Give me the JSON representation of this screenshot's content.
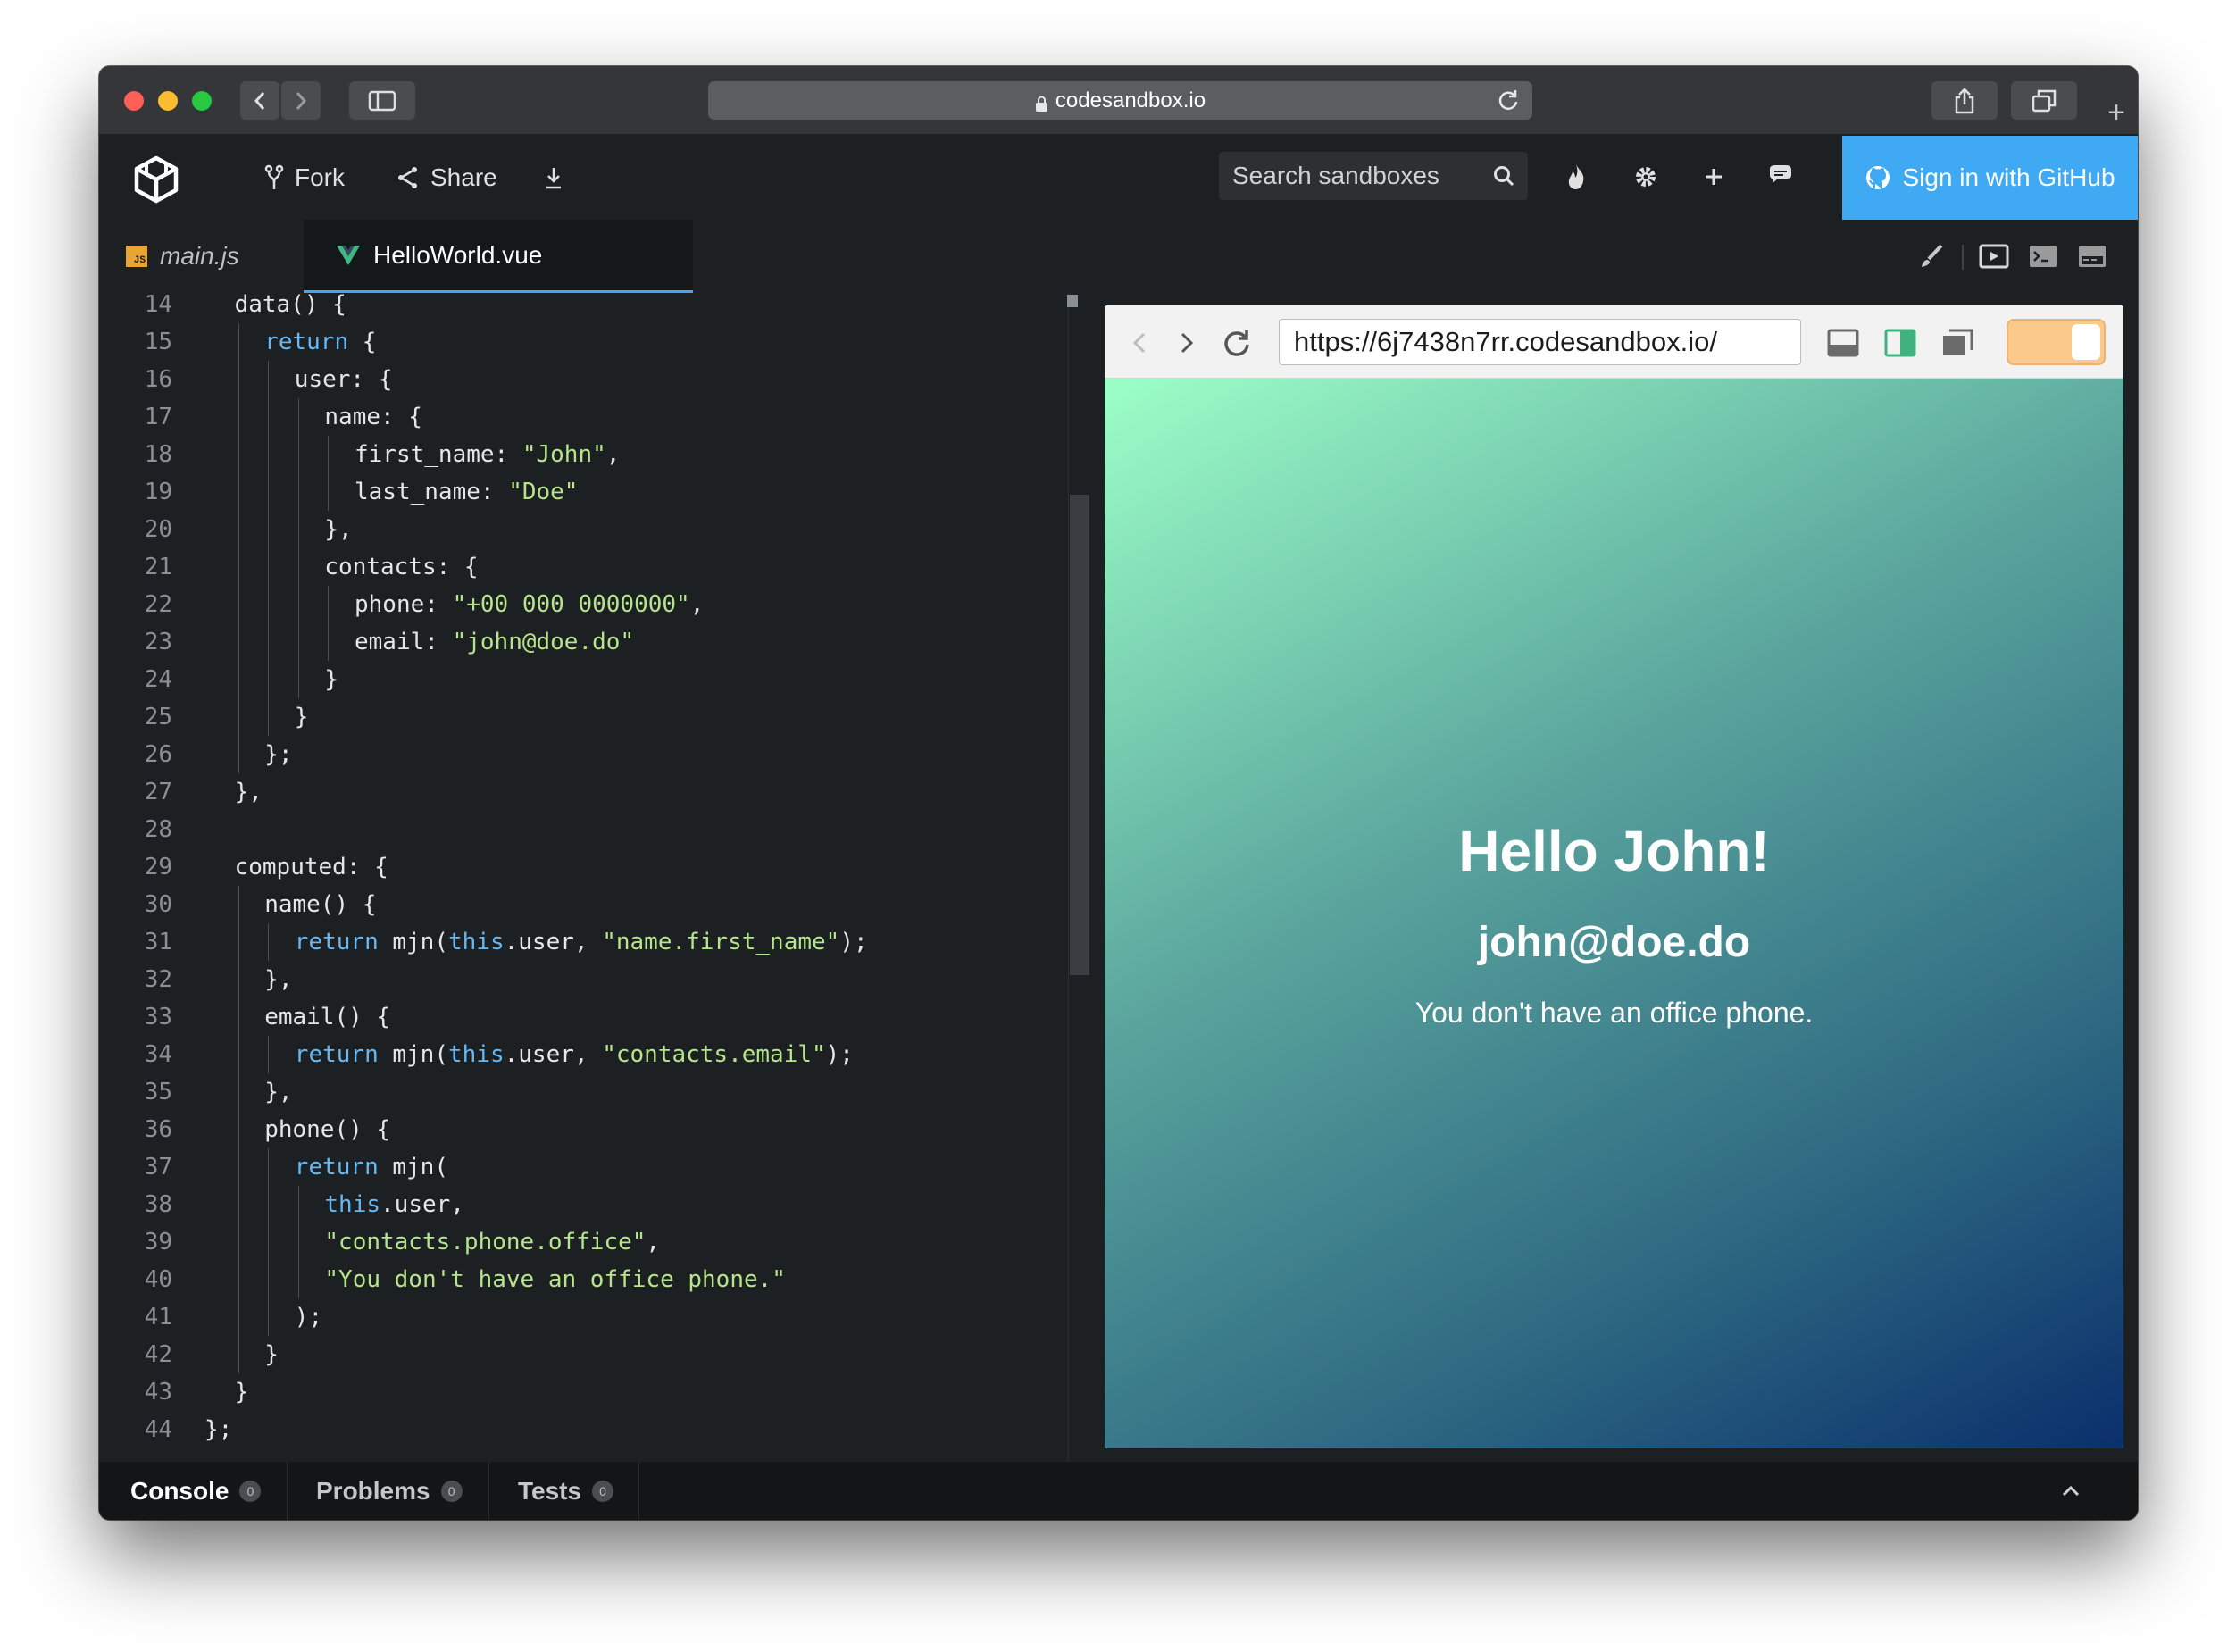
{
  "browser_chrome": {
    "address": "codesandbox.io",
    "traffic_lights": [
      "#fe5f57",
      "#febc2e",
      "#28c840"
    ]
  },
  "header": {
    "fork_label": "Fork",
    "share_label": "Share",
    "search_placeholder": "Search sandboxes",
    "github_label": "Sign in with GitHub",
    "github_color": "#40a9f3"
  },
  "tabs": [
    {
      "label": "main.js",
      "icon": "js-file-icon",
      "active": false
    },
    {
      "label": "HelloWorld.vue",
      "icon": "vue-icon",
      "active": true
    }
  ],
  "editor": {
    "lines": [
      {
        "n": "14",
        "indent": 1,
        "segs": [
          {
            "t": "data() {",
            "c": ""
          }
        ]
      },
      {
        "n": "15",
        "indent": 2,
        "segs": [
          {
            "t": "return",
            "c": "kw"
          },
          {
            "t": " {",
            "c": ""
          }
        ]
      },
      {
        "n": "16",
        "indent": 3,
        "segs": [
          {
            "t": "user: {",
            "c": ""
          }
        ]
      },
      {
        "n": "17",
        "indent": 4,
        "segs": [
          {
            "t": "name: {",
            "c": ""
          }
        ]
      },
      {
        "n": "18",
        "indent": 5,
        "segs": [
          {
            "t": "first_name: ",
            "c": ""
          },
          {
            "t": "\"John\"",
            "c": "str"
          },
          {
            "t": ",",
            "c": ""
          }
        ]
      },
      {
        "n": "19",
        "indent": 5,
        "segs": [
          {
            "t": "last_name: ",
            "c": ""
          },
          {
            "t": "\"Doe\"",
            "c": "str"
          }
        ]
      },
      {
        "n": "20",
        "indent": 4,
        "segs": [
          {
            "t": "},",
            "c": ""
          }
        ]
      },
      {
        "n": "21",
        "indent": 4,
        "segs": [
          {
            "t": "contacts: {",
            "c": ""
          }
        ]
      },
      {
        "n": "22",
        "indent": 5,
        "segs": [
          {
            "t": "phone: ",
            "c": ""
          },
          {
            "t": "\"+00 000 0000000\"",
            "c": "str"
          },
          {
            "t": ",",
            "c": ""
          }
        ]
      },
      {
        "n": "23",
        "indent": 5,
        "segs": [
          {
            "t": "email: ",
            "c": ""
          },
          {
            "t": "\"john@doe.do\"",
            "c": "str"
          }
        ]
      },
      {
        "n": "24",
        "indent": 4,
        "segs": [
          {
            "t": "}",
            "c": ""
          }
        ]
      },
      {
        "n": "25",
        "indent": 3,
        "segs": [
          {
            "t": "}",
            "c": ""
          }
        ]
      },
      {
        "n": "26",
        "indent": 2,
        "segs": [
          {
            "t": "};",
            "c": ""
          }
        ]
      },
      {
        "n": "27",
        "indent": 1,
        "segs": [
          {
            "t": "},",
            "c": ""
          }
        ]
      },
      {
        "n": "28",
        "indent": 0,
        "segs": []
      },
      {
        "n": "29",
        "indent": 1,
        "segs": [
          {
            "t": "computed: {",
            "c": ""
          }
        ]
      },
      {
        "n": "30",
        "indent": 2,
        "segs": [
          {
            "t": "name() {",
            "c": ""
          }
        ]
      },
      {
        "n": "31",
        "indent": 3,
        "segs": [
          {
            "t": "return",
            "c": "kw"
          },
          {
            "t": " mjn(",
            "c": ""
          },
          {
            "t": "this",
            "c": "kw"
          },
          {
            "t": ".user, ",
            "c": ""
          },
          {
            "t": "\"name.first_name\"",
            "c": "str"
          },
          {
            "t": ");",
            "c": ""
          }
        ]
      },
      {
        "n": "32",
        "indent": 2,
        "segs": [
          {
            "t": "},",
            "c": ""
          }
        ]
      },
      {
        "n": "33",
        "indent": 2,
        "segs": [
          {
            "t": "email() {",
            "c": ""
          }
        ]
      },
      {
        "n": "34",
        "indent": 3,
        "segs": [
          {
            "t": "return",
            "c": "kw"
          },
          {
            "t": " mjn(",
            "c": ""
          },
          {
            "t": "this",
            "c": "kw"
          },
          {
            "t": ".user, ",
            "c": ""
          },
          {
            "t": "\"contacts.email\"",
            "c": "str"
          },
          {
            "t": ");",
            "c": ""
          }
        ]
      },
      {
        "n": "35",
        "indent": 2,
        "segs": [
          {
            "t": "},",
            "c": ""
          }
        ]
      },
      {
        "n": "36",
        "indent": 2,
        "segs": [
          {
            "t": "phone() {",
            "c": ""
          }
        ]
      },
      {
        "n": "37",
        "indent": 3,
        "segs": [
          {
            "t": "return",
            "c": "kw"
          },
          {
            "t": " mjn(",
            "c": ""
          }
        ]
      },
      {
        "n": "38",
        "indent": 4,
        "segs": [
          {
            "t": "this",
            "c": "kw"
          },
          {
            "t": ".user,",
            "c": ""
          }
        ]
      },
      {
        "n": "39",
        "indent": 4,
        "segs": [
          {
            "t": "\"contacts.phone.office\"",
            "c": "str"
          },
          {
            "t": ",",
            "c": ""
          }
        ]
      },
      {
        "n": "40",
        "indent": 4,
        "segs": [
          {
            "t": "\"You don't have an office phone.\"",
            "c": "str"
          }
        ]
      },
      {
        "n": "41",
        "indent": 3,
        "segs": [
          {
            "t": ");",
            "c": ""
          }
        ]
      },
      {
        "n": "42",
        "indent": 2,
        "segs": [
          {
            "t": "}",
            "c": ""
          }
        ]
      },
      {
        "n": "43",
        "indent": 1,
        "segs": [
          {
            "t": "}",
            "c": ""
          }
        ]
      },
      {
        "n": "44",
        "indent": 0,
        "segs": [
          {
            "t": "};",
            "c": ""
          }
        ]
      }
    ]
  },
  "preview": {
    "url": "https://6j7438n7rr.codesandbox.io/",
    "greeting": "Hello John!",
    "email": "john@doe.do",
    "phone": "You don't have an office phone."
  },
  "bottom_tabs": [
    {
      "label": "Console",
      "count": "0",
      "active": true
    },
    {
      "label": "Problems",
      "count": "0",
      "active": false
    },
    {
      "label": "Tests",
      "count": "0",
      "active": false
    }
  ]
}
